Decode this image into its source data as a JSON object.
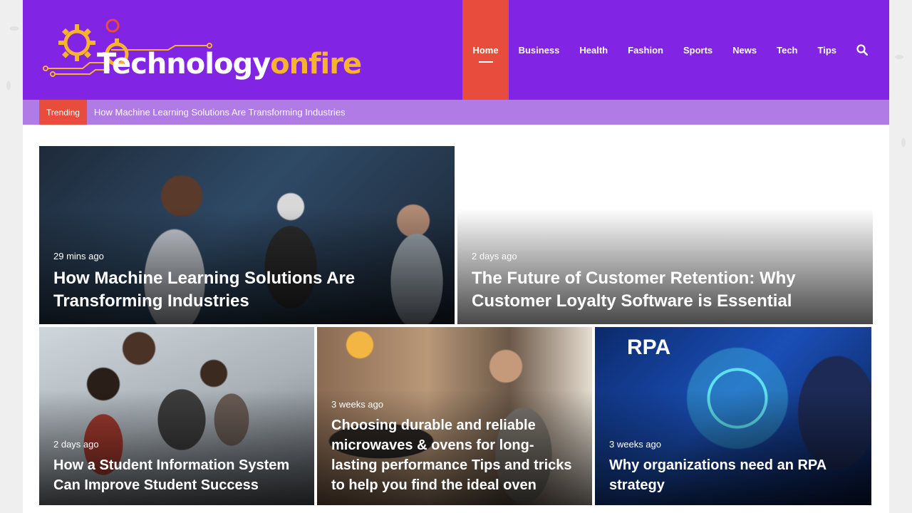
{
  "site": {
    "logo_part1": "Technology",
    "logo_part2": "onfire",
    "brand_purple": "#8224e3",
    "accent_red": "#e74c3c",
    "logo_orange": "#f7b32b"
  },
  "nav": {
    "items": [
      {
        "label": "Home"
      },
      {
        "label": "Business"
      },
      {
        "label": "Health"
      },
      {
        "label": "Fashion"
      },
      {
        "label": "Sports"
      },
      {
        "label": "News"
      },
      {
        "label": "Tech"
      },
      {
        "label": "Tips"
      }
    ],
    "search_icon": "search-icon"
  },
  "trending": {
    "badge": "Trending",
    "headline": "How Machine Learning Solutions Are Transforming Industries"
  },
  "posts": [
    {
      "time": "29 mins ago",
      "title": "How Machine Learning Solutions Are Transforming Industries"
    },
    {
      "time": "2 days ago",
      "title": "The Future of Customer Retention: Why Customer Loyalty Software is Essential"
    },
    {
      "time": "2 days ago",
      "title": "How a Student Information System Can Improve Student Success"
    },
    {
      "time": "3 weeks ago",
      "title": "Choosing durable and reliable microwaves & ovens for long-lasting performance Tips and tricks to help you find the ideal oven"
    },
    {
      "time": "3 weeks ago",
      "title": "Why organizations need an RPA strategy"
    }
  ]
}
